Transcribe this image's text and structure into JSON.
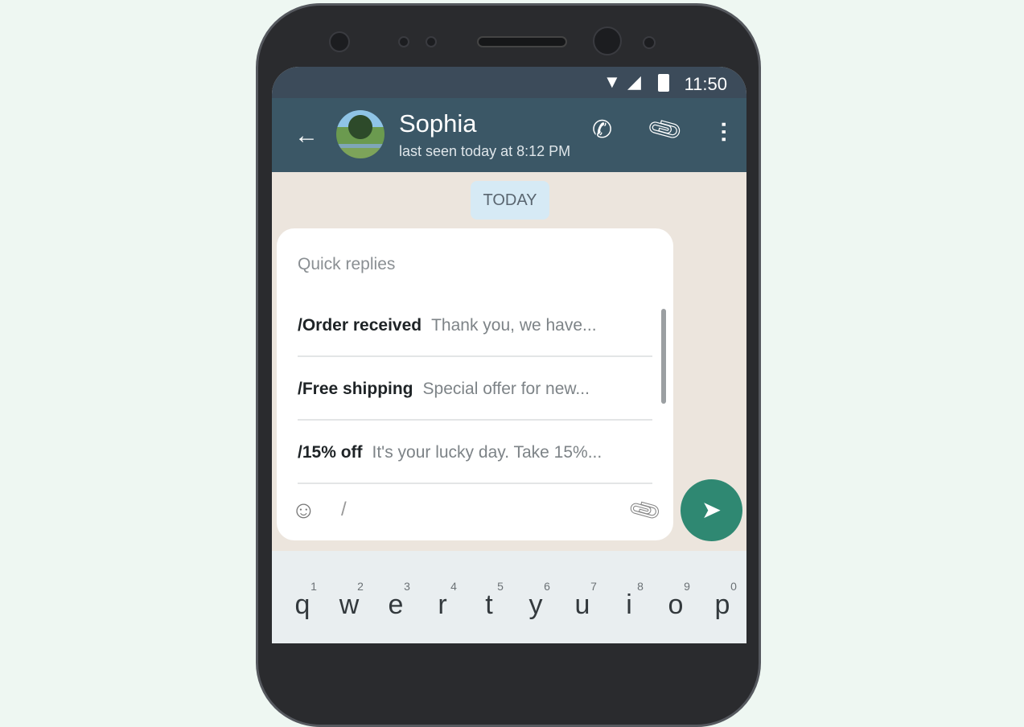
{
  "status_bar": {
    "time": "11:50"
  },
  "header": {
    "name": "Sophia",
    "last_seen": "last seen today at 8:12 PM"
  },
  "date_chip": "TODAY",
  "quick_replies": {
    "title": "Quick replies",
    "items": [
      {
        "shortcut": "/Order received",
        "preview": "Thank you, we have..."
      },
      {
        "shortcut": "/Free shipping",
        "preview": "Special offer for new..."
      },
      {
        "shortcut": "/15% off",
        "preview": "It's your lucky day. Take 15%..."
      }
    ]
  },
  "composer": {
    "value": "/"
  },
  "keyboard": {
    "keys": [
      {
        "n": "1",
        "l": "q"
      },
      {
        "n": "2",
        "l": "w"
      },
      {
        "n": "3",
        "l": "e"
      },
      {
        "n": "4",
        "l": "r"
      },
      {
        "n": "5",
        "l": "t"
      },
      {
        "n": "6",
        "l": "y"
      },
      {
        "n": "7",
        "l": "u"
      },
      {
        "n": "8",
        "l": "i"
      },
      {
        "n": "9",
        "l": "o"
      },
      {
        "n": "0",
        "l": "p"
      }
    ]
  },
  "colors": {
    "header": "#3b5766",
    "send": "#2f8872"
  }
}
